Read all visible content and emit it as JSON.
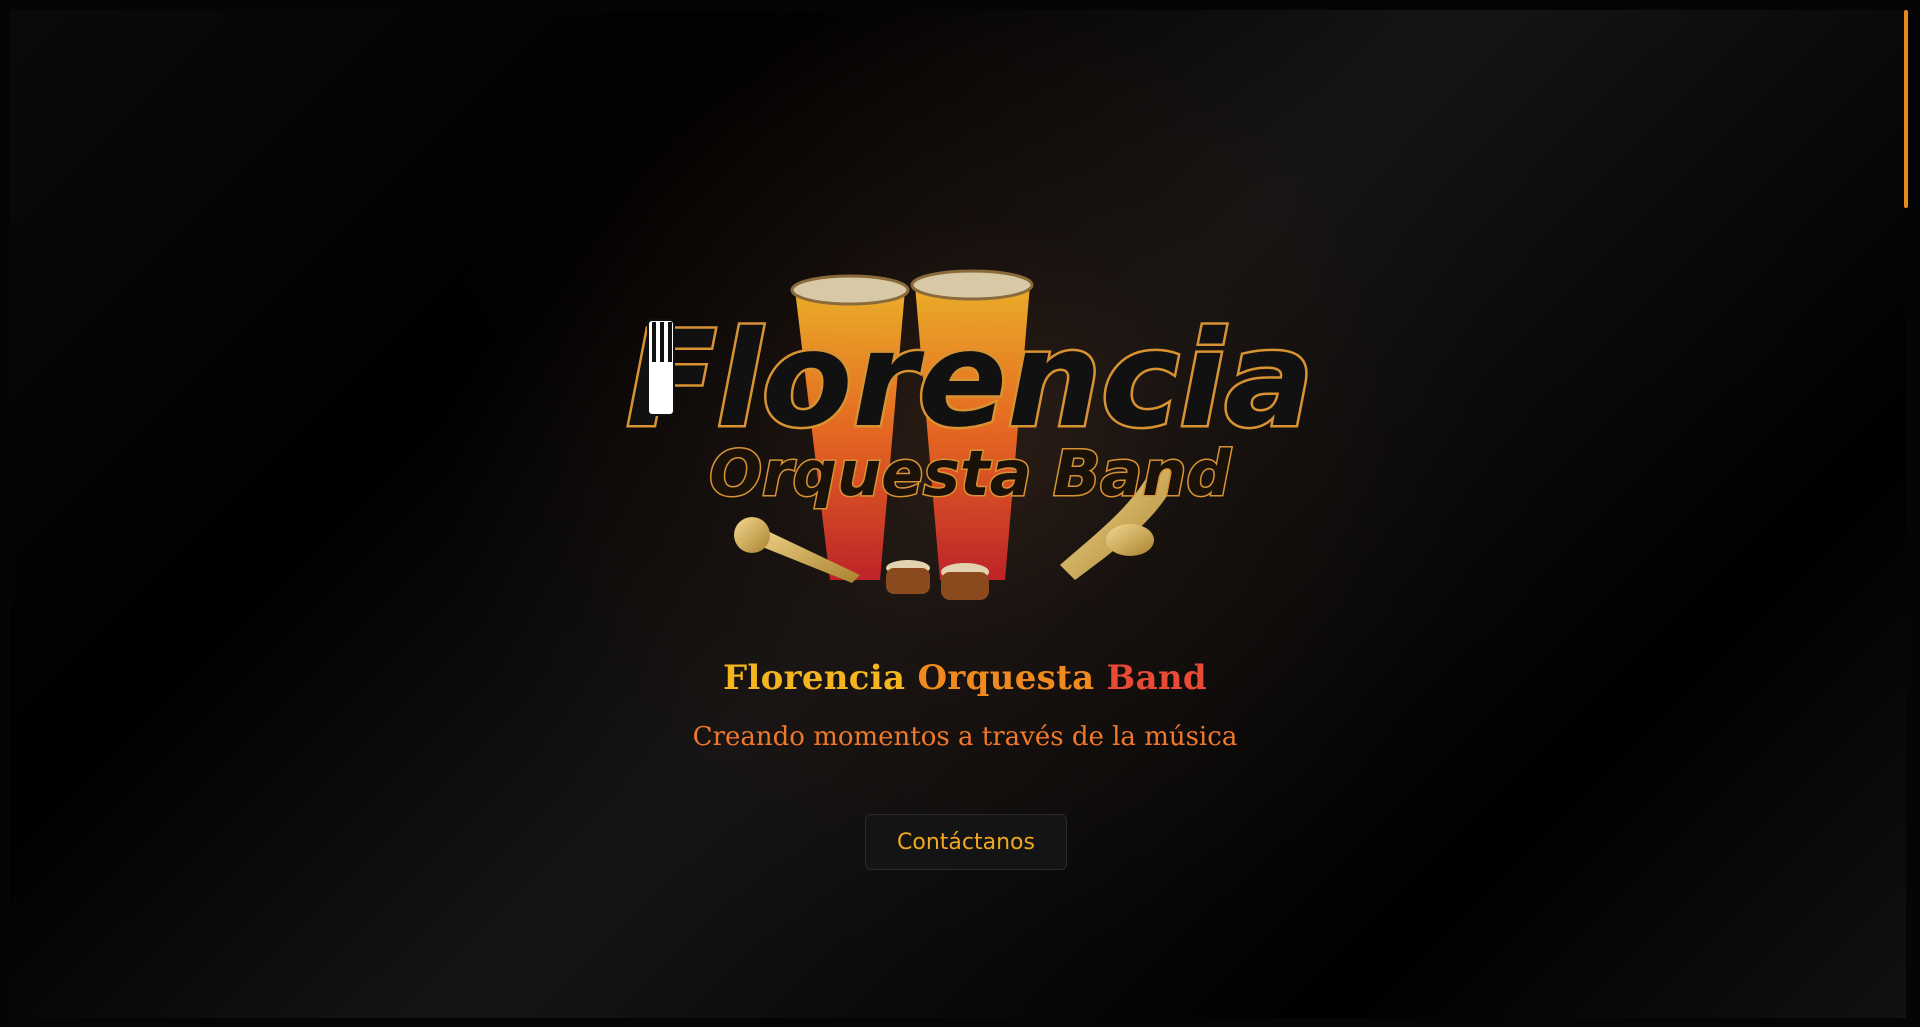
{
  "hero": {
    "logo": {
      "wordmark_main": "Florencia",
      "wordmark_sub": "Orquesta Band"
    },
    "title_part1": "Florencia",
    "title_part2": "Orquesta",
    "title_part3": "Band",
    "subtitle": "Creando momentos a través de la música",
    "cta_label": "Contáctanos"
  },
  "colors": {
    "accent_gold": "#f5b51e",
    "accent_orange": "#f08a1e",
    "accent_red": "#e84a35",
    "scroll_thumb": "#e88a1a"
  }
}
